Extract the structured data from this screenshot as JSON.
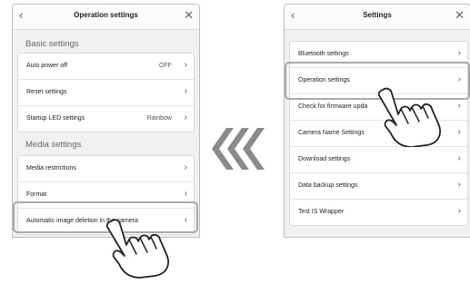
{
  "left_screen": {
    "title": "Operation settings",
    "basic_section": "Basic settings",
    "basic_rows": [
      {
        "label": "Auto power off",
        "value": "OFF"
      },
      {
        "label": "Reset settings",
        "value": ""
      },
      {
        "label": "Startup LED settings",
        "value": "Rainbow"
      }
    ],
    "media_section": "Media settings",
    "media_rows": [
      {
        "label": "Media restrictions"
      },
      {
        "label": "Format"
      },
      {
        "label": "Automatic image deletion in the camera"
      }
    ]
  },
  "right_screen": {
    "title": "Settings",
    "rows": [
      {
        "label": "Bluetooth settings"
      },
      {
        "label": "Operation settings"
      },
      {
        "label": "Check for firmware upda"
      },
      {
        "label": "Camera Name Settings"
      },
      {
        "label": "Download settings"
      },
      {
        "label": "Data backup settings"
      },
      {
        "label": "Test IS Wrapper"
      }
    ]
  },
  "icons": {
    "back": "chevron-left-icon",
    "close": "close-icon",
    "row_arrow": "chevron-right-icon",
    "hand": "pointing-hand-icon",
    "flow": "triple-chevron-left-icon"
  },
  "colors": {
    "highlight": "#a8a8a8",
    "flow_arrows": "#8a8a8a"
  }
}
